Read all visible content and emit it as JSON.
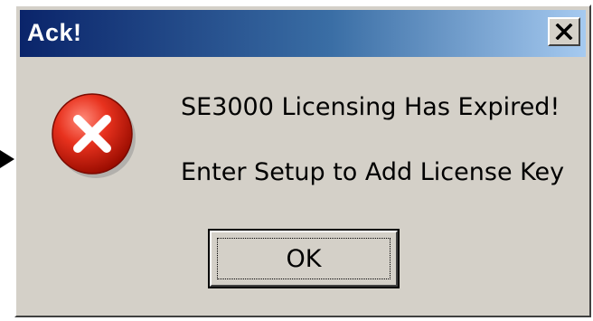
{
  "dialog": {
    "title": "Ack!",
    "close_label": "Close",
    "icon": "error-icon",
    "message_line1": "SE3000 Licensing Has Expired!",
    "message_line2": "Enter Setup to Add License Key",
    "ok_label": "OK"
  },
  "colors": {
    "title_bar_start": "#0a246a",
    "title_bar_end": "#a6caf0",
    "dialog_bg": "#d4d0c8",
    "error_red": "#d81e06"
  }
}
